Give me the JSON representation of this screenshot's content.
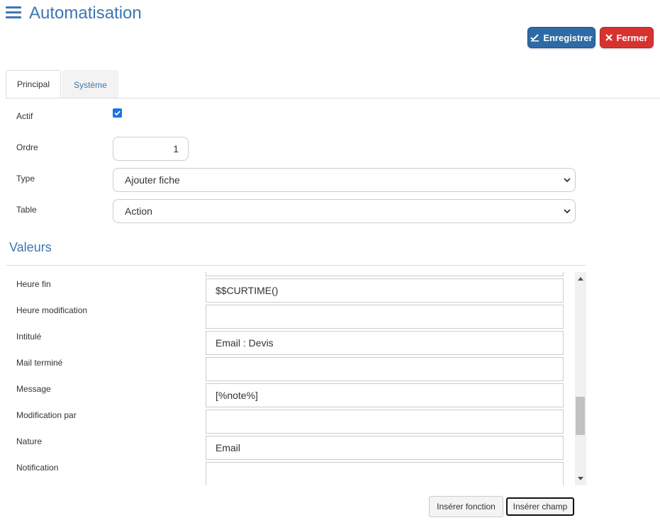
{
  "header": {
    "title": "Automatisation",
    "save_label": "Enregistrer",
    "close_label": "Fermer"
  },
  "tabs": [
    {
      "label": "Principal",
      "active": true
    },
    {
      "label": "Système",
      "active": false
    }
  ],
  "form": {
    "actif_label": "Actif",
    "actif_checked": true,
    "ordre_label": "Ordre",
    "ordre_value": "1",
    "type_label": "Type",
    "type_value": "Ajouter fiche",
    "table_label": "Table",
    "table_value": "Action"
  },
  "values_section": {
    "title": "Valeurs",
    "rows": [
      {
        "label": "Heure fin",
        "value": "$$CURTIME()"
      },
      {
        "label": "Heure modification",
        "value": ""
      },
      {
        "label": "Intitulé",
        "value": "Email : Devis"
      },
      {
        "label": "Mail terminé",
        "value": ""
      },
      {
        "label": "Message",
        "value": "[%note%]"
      },
      {
        "label": "Modification par",
        "value": ""
      },
      {
        "label": "Nature",
        "value": "Email"
      },
      {
        "label": "Notification",
        "value": ""
      }
    ]
  },
  "footer": {
    "insert_function_label": "Insérer fonction",
    "insert_field_label": "Insérer champ"
  },
  "colors": {
    "accent": "#3c77b1",
    "save": "#2e6aa6",
    "close": "#d7332e"
  },
  "icons": [
    "menu-icon",
    "save-check-icon",
    "close-x-icon",
    "checkbox-check-icon",
    "chevron-down-icon",
    "scroll-up-icon",
    "scroll-down-icon"
  ]
}
